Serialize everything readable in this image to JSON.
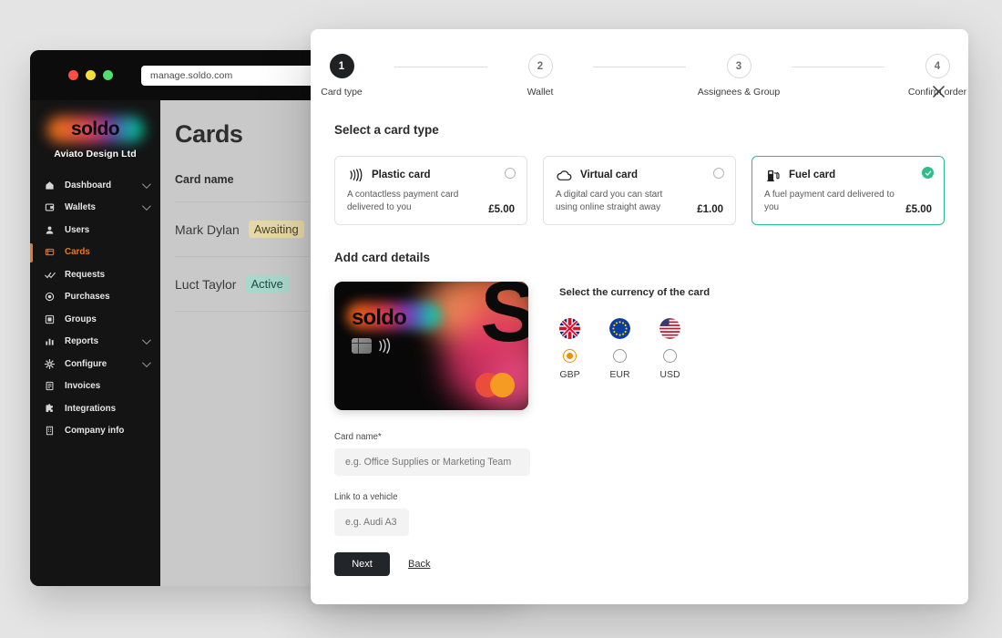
{
  "browser": {
    "url": "manage.soldo.com",
    "traffic_lights": [
      "close-red",
      "minimize-yellow",
      "maximize-green"
    ]
  },
  "sidebar": {
    "brand": "soldo",
    "company": "Aviato Design Ltd",
    "items": [
      {
        "label": "Dashboard",
        "icon": "home-icon",
        "expandable": true,
        "active": false
      },
      {
        "label": "Wallets",
        "icon": "wallet-icon",
        "expandable": true,
        "active": false
      },
      {
        "label": "Users",
        "icon": "user-icon",
        "expandable": false,
        "active": false
      },
      {
        "label": "Cards",
        "icon": "card-icon",
        "expandable": false,
        "active": true
      },
      {
        "label": "Requests",
        "icon": "check-check-icon",
        "expandable": false,
        "active": false
      },
      {
        "label": "Purchases",
        "icon": "bag-icon",
        "expandable": false,
        "active": false
      },
      {
        "label": "Groups",
        "icon": "groups-icon",
        "expandable": false,
        "active": false
      },
      {
        "label": "Reports",
        "icon": "bar-chart-icon",
        "expandable": true,
        "active": false
      },
      {
        "label": "Configure",
        "icon": "gear-icon",
        "expandable": true,
        "active": false
      },
      {
        "label": "Invoices",
        "icon": "invoice-icon",
        "expandable": false,
        "active": false
      },
      {
        "label": "Integrations",
        "icon": "puzzle-icon",
        "expandable": false,
        "active": false
      },
      {
        "label": "Company info",
        "icon": "building-icon",
        "expandable": false,
        "active": false
      }
    ]
  },
  "page": {
    "title": "Cards",
    "table": {
      "columns": [
        "Card name"
      ],
      "rows": [
        {
          "name": "Mark Dylan",
          "status": "Awaiting",
          "status_kind": "awaiting"
        },
        {
          "name": "Luct Taylor",
          "status": "Active",
          "status_kind": "active"
        }
      ]
    }
  },
  "modal": {
    "close_icon": "close-icon",
    "stepper": [
      {
        "number": "1",
        "label": "Card type",
        "state": "current"
      },
      {
        "number": "2",
        "label": "Wallet",
        "state": "upcoming"
      },
      {
        "number": "3",
        "label": "Assignees & Group",
        "state": "upcoming"
      },
      {
        "number": "4",
        "label": "Confirm order",
        "state": "upcoming"
      }
    ],
    "card_type_section": {
      "title": "Select a card type",
      "options": [
        {
          "name": "Plastic card",
          "icon": "contactless-icon",
          "description": "A contactless payment card delivered to you",
          "price": "£5.00",
          "selected": false
        },
        {
          "name": "Virtual card",
          "icon": "cloud-icon",
          "description": "A digital card you can start using online straight away",
          "price": "£1.00",
          "selected": false
        },
        {
          "name": "Fuel card",
          "icon": "fuel-pump-icon",
          "description": "A fuel payment card delivered to you",
          "price": "£5.00",
          "selected": true
        }
      ]
    },
    "details_section": {
      "title": "Add card details",
      "card_preview": {
        "brand": "soldo",
        "big_letter": "S",
        "network": "mastercard",
        "icons": [
          "chip-icon",
          "contactless-icon"
        ]
      },
      "currency": {
        "title": "Select the currency of the card",
        "options": [
          {
            "code": "GBP",
            "flag": "uk-flag-icon",
            "selected": true
          },
          {
            "code": "EUR",
            "flag": "eu-flag-icon",
            "selected": false
          },
          {
            "code": "USD",
            "flag": "us-flag-icon",
            "selected": false
          }
        ]
      },
      "fields": [
        {
          "label": "Card name*",
          "placeholder": "e.g. Office Supplies or Marketing Team",
          "value": "",
          "width": "full"
        },
        {
          "label": "Link to a vehicle",
          "placeholder": "e.g. Audi A3",
          "value": "",
          "width": "half"
        }
      ],
      "actions": {
        "primary": "Next",
        "secondary": "Back"
      }
    }
  },
  "colors": {
    "accent_green": "#2bbd8a",
    "accent_orange": "#e07b2a",
    "radio_orange": "#f09000",
    "dark": "#1f2123",
    "page_bg": "#e4e4e4"
  }
}
